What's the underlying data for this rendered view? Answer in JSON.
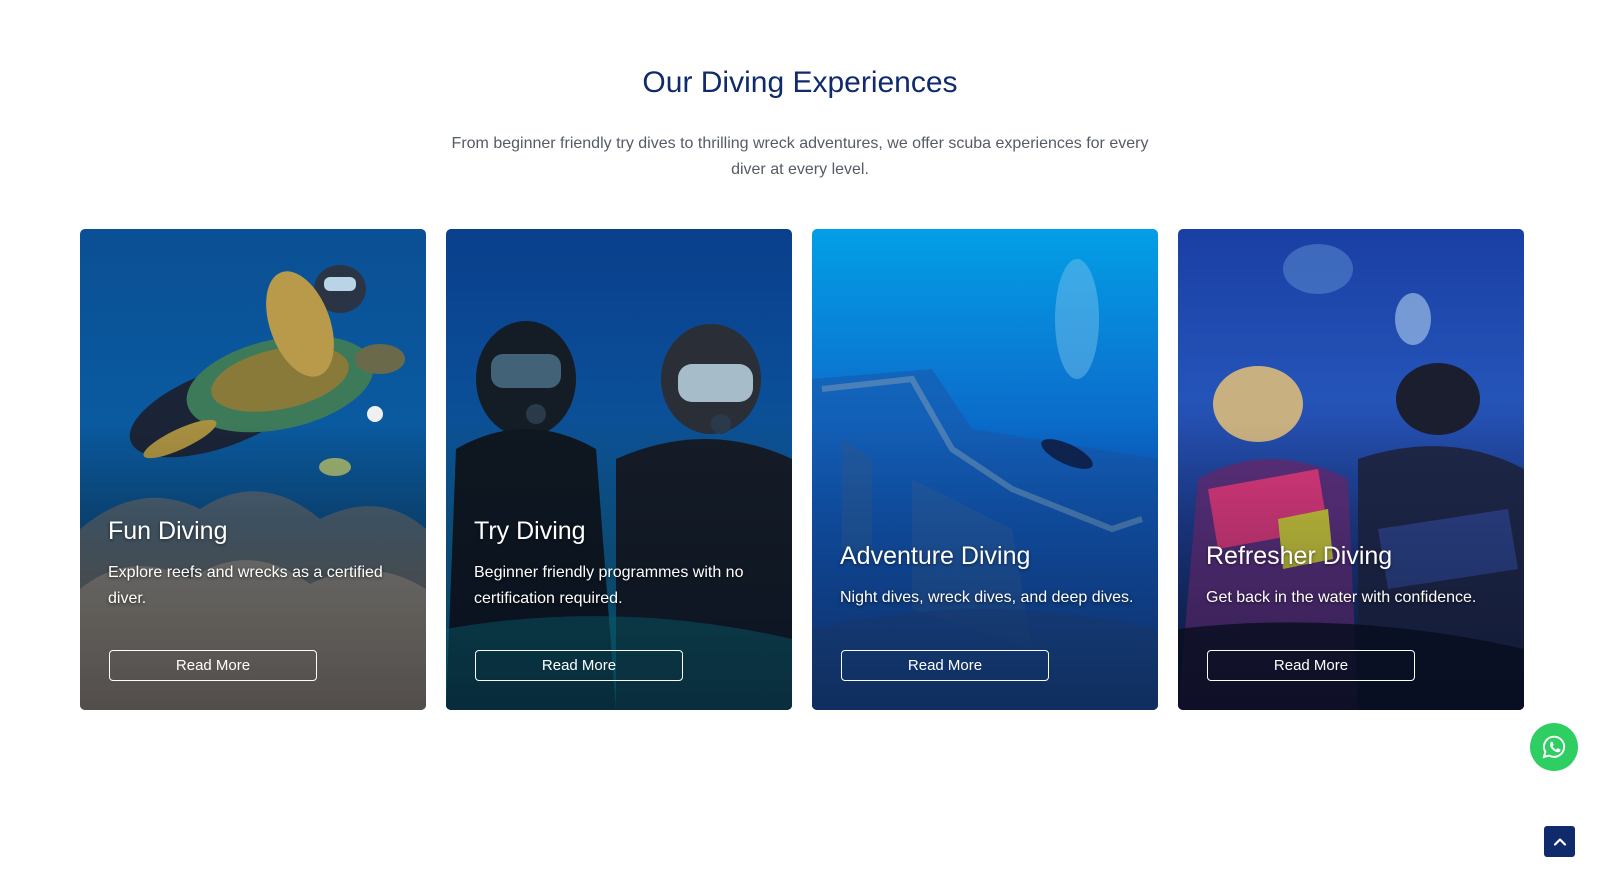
{
  "section": {
    "title": "Our Diving Experiences",
    "subtitle": "From beginner friendly try dives to thrilling wreck adventures, we offer scuba experiences for every diver at every level."
  },
  "cards": [
    {
      "title": "Fun Diving",
      "description": "Explore reefs and wrecks as a certified diver.",
      "button": "Read More",
      "image": "turtle-diver-image"
    },
    {
      "title": "Try Diving",
      "description": "Beginner friendly programmes with no certification required.",
      "button": "Read More",
      "image": "two-divers-image"
    },
    {
      "title": "Adventure Diving",
      "description": "Night dives, wreck dives, and deep dives.",
      "button": "Read More",
      "image": "wreck-diver-image"
    },
    {
      "title": "Refresher Diving",
      "description": "Get back in the water with confidence.",
      "button": "Read More",
      "image": "buddy-divers-image"
    }
  ],
  "floating": {
    "whatsapp_icon": "whatsapp-icon",
    "whatsapp_color": "#2fce62",
    "scroll_top_icon": "chevron-up-icon",
    "scroll_top_color": "#0f2b6b"
  },
  "colors": {
    "title": "#0f2b6b",
    "text": "#555b66"
  }
}
